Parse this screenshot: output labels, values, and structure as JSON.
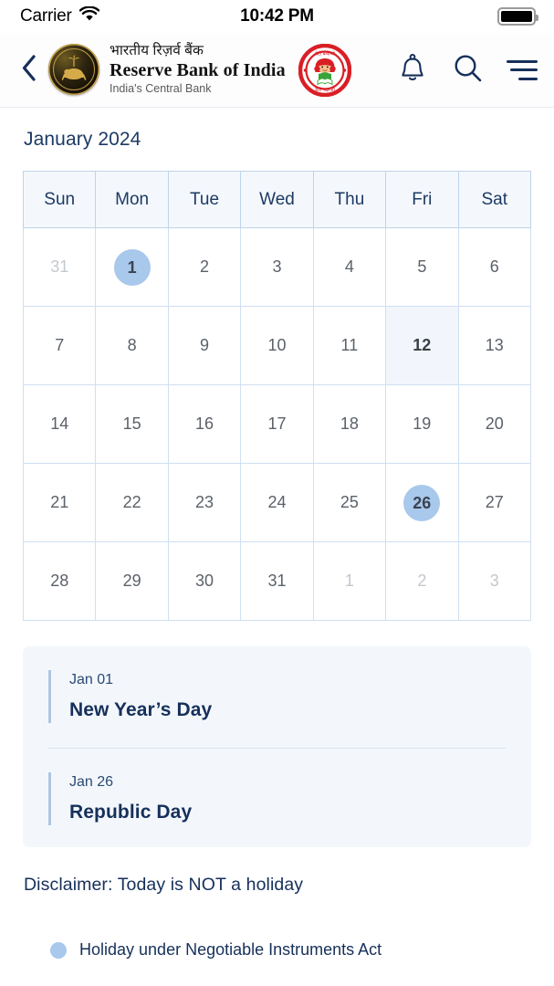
{
  "status_bar": {
    "carrier": "Carrier",
    "wifi_icon": "wifi-icon",
    "time": "10:42 PM",
    "battery_icon": "battery-full-icon"
  },
  "header": {
    "back_icon": "chevron-left-icon",
    "rbi_logo_icon": "rbi-seal-logo",
    "brand_hindi": "भारतीय रिज़र्व बैंक",
    "brand_english": "Reserve Bank of India",
    "brand_tagline": "India's Central Bank",
    "campaign_logo_icon": "beti-bachao-beti-padhao-logo",
    "notification_icon": "bell-icon",
    "search_icon": "search-icon",
    "menu_icon": "hamburger-menu-icon"
  },
  "calendar": {
    "month_title": "January 2024",
    "weekday_headers": [
      "Sun",
      "Mon",
      "Tue",
      "Wed",
      "Thu",
      "Fri",
      "Sat"
    ],
    "weeks": [
      [
        {
          "day": "31",
          "state": "outside"
        },
        {
          "day": "1",
          "state": "holiday"
        },
        {
          "day": "2",
          "state": "normal"
        },
        {
          "day": "3",
          "state": "normal"
        },
        {
          "day": "4",
          "state": "normal"
        },
        {
          "day": "5",
          "state": "normal"
        },
        {
          "day": "6",
          "state": "normal"
        }
      ],
      [
        {
          "day": "7",
          "state": "normal"
        },
        {
          "day": "8",
          "state": "normal"
        },
        {
          "day": "9",
          "state": "normal"
        },
        {
          "day": "10",
          "state": "normal"
        },
        {
          "day": "11",
          "state": "normal"
        },
        {
          "day": "12",
          "state": "today"
        },
        {
          "day": "13",
          "state": "normal"
        }
      ],
      [
        {
          "day": "14",
          "state": "normal"
        },
        {
          "day": "15",
          "state": "normal"
        },
        {
          "day": "16",
          "state": "normal"
        },
        {
          "day": "17",
          "state": "normal"
        },
        {
          "day": "18",
          "state": "normal"
        },
        {
          "day": "19",
          "state": "normal"
        },
        {
          "day": "20",
          "state": "normal"
        }
      ],
      [
        {
          "day": "21",
          "state": "normal"
        },
        {
          "day": "22",
          "state": "normal"
        },
        {
          "day": "23",
          "state": "normal"
        },
        {
          "day": "24",
          "state": "normal"
        },
        {
          "day": "25",
          "state": "normal"
        },
        {
          "day": "26",
          "state": "holiday"
        },
        {
          "day": "27",
          "state": "normal"
        }
      ],
      [
        {
          "day": "28",
          "state": "normal"
        },
        {
          "day": "29",
          "state": "normal"
        },
        {
          "day": "30",
          "state": "normal"
        },
        {
          "day": "31",
          "state": "normal"
        },
        {
          "day": "1",
          "state": "outside"
        },
        {
          "day": "2",
          "state": "outside"
        },
        {
          "day": "3",
          "state": "outside"
        }
      ]
    ]
  },
  "holidays": [
    {
      "date": "Jan 01",
      "name": "New Year’s Day"
    },
    {
      "date": "Jan 26",
      "name": "Republic Day"
    }
  ],
  "disclaimer": "Disclaimer: Today is NOT a holiday",
  "legend": [
    {
      "marker": "dot",
      "label": "Holiday under Negotiable Instruments Act"
    }
  ],
  "colors": {
    "accent_navy": "#16305a",
    "holiday_blue": "#a8c8ec",
    "grid_blue": "#cfe0f1",
    "card_bg": "#f3f7fc",
    "today_bg": "#f2f6fc"
  }
}
